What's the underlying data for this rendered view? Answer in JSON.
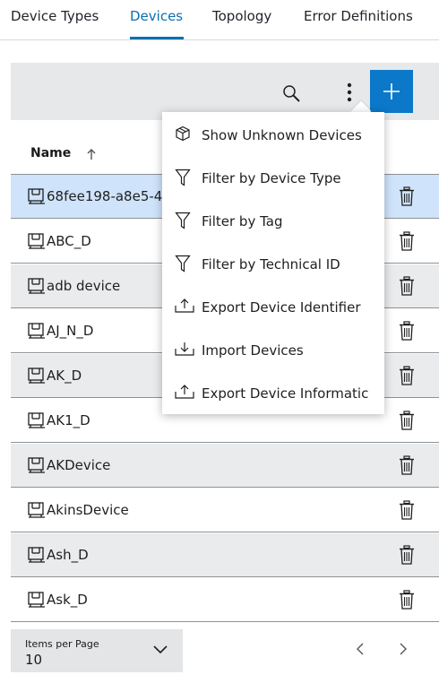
{
  "tabs": [
    {
      "label": "Device Types",
      "active": false
    },
    {
      "label": "Devices",
      "active": true
    },
    {
      "label": "Topology",
      "active": false
    },
    {
      "label": "Error Definitions",
      "active": false
    }
  ],
  "toolbar": {
    "search_icon": "search-icon",
    "more_icon": "more-vertical-icon",
    "add_icon": "plus-icon"
  },
  "table": {
    "header_name": "Name",
    "sort": "ascending",
    "rows": [
      {
        "name": "68fee198-a8e5-4",
        "selected": true
      },
      {
        "name": "ABC_D"
      },
      {
        "name": "adb device"
      },
      {
        "name": "AJ_N_D"
      },
      {
        "name": "AK_D"
      },
      {
        "name": "AK1_D"
      },
      {
        "name": "AKDevice"
      },
      {
        "name": "AkinsDevice"
      },
      {
        "name": "Ash_D"
      },
      {
        "name": "Ask_D"
      }
    ]
  },
  "menu": {
    "items": [
      {
        "label": "Show Unknown Devices",
        "icon": "cube-icon"
      },
      {
        "label": "Filter by Device Type",
        "icon": "filter-icon"
      },
      {
        "label": "Filter by Tag",
        "icon": "filter-icon"
      },
      {
        "label": "Filter by Technical ID",
        "icon": "filter-icon"
      },
      {
        "label": "Export Device Identifier",
        "icon": "upload-icon"
      },
      {
        "label": "Import Devices",
        "icon": "download-icon"
      },
      {
        "label": "Export Device Informatic",
        "icon": "upload-icon"
      }
    ]
  },
  "pagination": {
    "items_per_page_label": "Items per Page",
    "items_per_page_value": "10"
  },
  "colors": {
    "accent": "#0b78c9",
    "selected_row": "#cfe3fb",
    "alt_row": "#e9ebed"
  }
}
